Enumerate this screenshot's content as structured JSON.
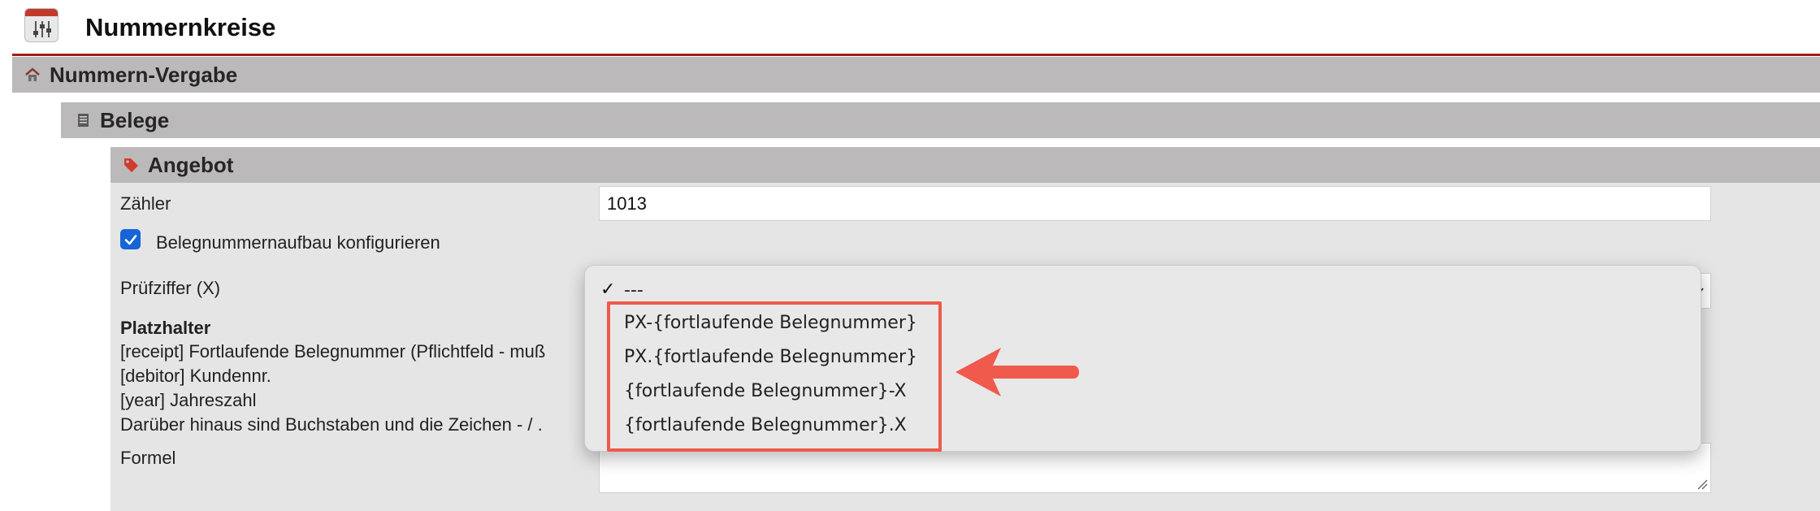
{
  "page": {
    "title": "Nummernkreise"
  },
  "sections": {
    "level1": "Nummern-Vergabe",
    "level2": "Belege",
    "level3": "Angebot"
  },
  "form": {
    "counter_label": "Zähler",
    "counter_value": "1013",
    "configure_checkbox_label": "Belegnummernaufbau konfigurieren",
    "configure_checked": true,
    "checkdigit_label": "Prüfziffer (X)",
    "placeholder_heading": "Platzhalter",
    "placeholder_lines": [
      "[receipt] Fortlaufende Belegnummer (Pflichtfeld - muß",
      "[debitor] Kundennr.",
      "[year] Jahreszahl",
      "Darüber hinaus sind Buchstaben und die Zeichen - / ."
    ],
    "formula_label": "Formel"
  },
  "dropdown": {
    "selected": "---",
    "options": [
      "PX-{fortlaufende Belegnummer}",
      "PX.{fortlaufende Belegnummer}",
      "{fortlaufende Belegnummer}-X",
      "{fortlaufende Belegnummer}.X"
    ]
  },
  "icons": {
    "app": "settings-sliders-icon",
    "level1": "home-icon",
    "level2": "document-icon",
    "level3": "tag-icon",
    "annotation": "arrow-left-icon"
  },
  "colors": {
    "accent_red": "#a31c1c",
    "header_gray": "#bbb9ba",
    "panel_gray": "#e6e5e5",
    "annotation_red": "#ef5a4c",
    "checkbox_blue": "#1565d8"
  }
}
